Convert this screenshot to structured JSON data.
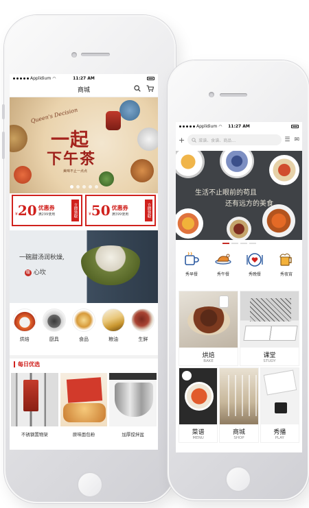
{
  "screen_left": {
    "status": {
      "carrier": "Applidium",
      "time": "11:27 AM"
    },
    "nav": {
      "title": "商城",
      "search_icon": "search-icon",
      "cart_icon": "cart-icon"
    },
    "banner": {
      "script_text": "Queen's Decision",
      "title_line1": "一起",
      "title_line2": "下午茶",
      "subtitle": "美味不止一点点",
      "pager_count": 5
    },
    "coupons": [
      {
        "currency": "¥",
        "amount": "20",
        "label": "优惠券",
        "condition": "满299使用",
        "action": "立即领取"
      },
      {
        "currency": "¥",
        "amount": "50",
        "label": "优惠券",
        "condition": "满399使用",
        "action": "立即领取"
      }
    ],
    "soup_banner": {
      "line1": "一碗甜汤润秋燥,",
      "line2_pre": "",
      "seal": "暖",
      "line2_post": "心坎"
    },
    "categories": [
      {
        "label": "烘焙"
      },
      {
        "label": "厨具"
      },
      {
        "label": "食品"
      },
      {
        "label": "粮油"
      },
      {
        "label": "生鲜"
      }
    ],
    "daily_title": "每日优选",
    "products": [
      {
        "name": "不锈钢置物架"
      },
      {
        "name": "原味面包粉"
      },
      {
        "name": "加厚搅拌盆"
      }
    ]
  },
  "screen_right": {
    "status": {
      "carrier": "Applidium",
      "time": "11:27 AM"
    },
    "search": {
      "placeholder": "菜谱、食谱、商品…"
    },
    "banner": {
      "line1": "生活不止眼前的苟且",
      "line2": "还有远方的美食"
    },
    "categories": [
      {
        "label": "秀早餐"
      },
      {
        "label": "秀午餐"
      },
      {
        "label": "秀晚餐"
      },
      {
        "label": "秀夜宵"
      }
    ],
    "tiles": [
      {
        "zh": "烘焙",
        "en": "BAKE"
      },
      {
        "zh": "课堂",
        "en": "STUDY"
      },
      {
        "zh": "菜谱",
        "en": "MENU"
      },
      {
        "zh": "商城",
        "en": "SHOP"
      },
      {
        "zh": "秀播",
        "en": "PLAY"
      }
    ]
  },
  "colors": {
    "accent": "#d0211d",
    "brand_dark": "#3f4246"
  }
}
